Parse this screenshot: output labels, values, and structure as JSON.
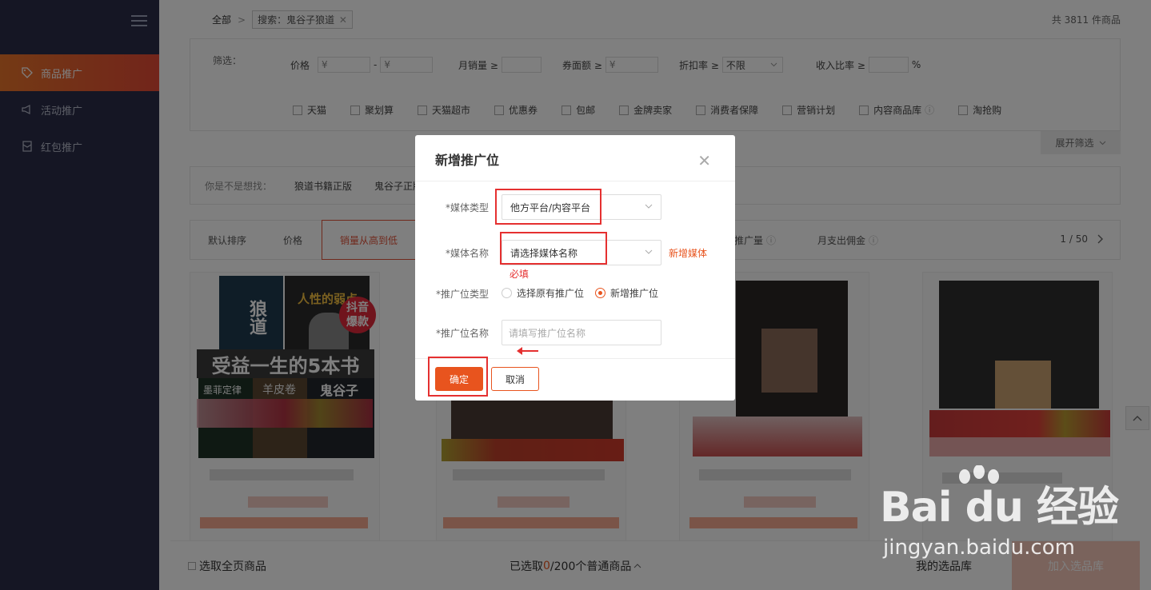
{
  "sidebar": {
    "items": [
      {
        "label": "商品推广",
        "icon": "tag-icon",
        "active": true
      },
      {
        "label": "活动推广",
        "icon": "megaphone-icon",
        "active": false
      },
      {
        "label": "红包推广",
        "icon": "red-packet-icon",
        "active": false
      }
    ]
  },
  "breadcrumb": {
    "root": "全部",
    "separator": ">",
    "search_tag": "搜索：鬼谷子狼道",
    "tag_close": "✕"
  },
  "total_text": "共 3811 件商品",
  "filters": {
    "label": "筛选：",
    "price_label": "价格",
    "price_from_placeholder": "¥",
    "price_dash": "-",
    "price_to_placeholder": "¥",
    "monthly_sales_label": "月销量 ≥",
    "coupon_label": "券面额 ≥",
    "coupon_placeholder": "¥",
    "discount_label": "折扣率 ≥",
    "discount_value": "不限",
    "commission_label": "收入比率 ≥",
    "percent": "%",
    "checkboxes": [
      "天猫",
      "聚划算",
      "天猫超市",
      "优惠券",
      "包邮",
      "金牌卖家",
      "消费者保障",
      "营销计划",
      "内容商品库",
      "淘抢购"
    ],
    "expand_label": "展开筛选"
  },
  "suggest": {
    "label": "你是不是想找：",
    "items": [
      "狼道书籍正版",
      "鬼谷子正版"
    ]
  },
  "sort": {
    "items": [
      "默认排序",
      "价格",
      "销量从高到低"
    ],
    "right_items": [
      "推广量",
      "月支出佣金"
    ],
    "pager": "1 / 50"
  },
  "product_card_1": {
    "book_title_1": "狼道",
    "book_title_2": "人性的弱点",
    "banner": "受益一生的5本书",
    "badge_line1": "抖音",
    "badge_line2": "爆款",
    "book_3": "墨菲定律",
    "book_4": "羊皮卷",
    "book_5": "鬼谷子"
  },
  "bottom_bar": {
    "select_all": "选取全页商品",
    "selected_prefix": "已选取",
    "selected_count": "0",
    "selected_suffix": "/200个普通商品",
    "my_library": "我的选品库",
    "add_library": "加入选品库"
  },
  "modal": {
    "title": "新增推广位",
    "close": "✕",
    "media_type_label": "*媒体类型",
    "media_type_value": "他方平台/内容平台",
    "media_name_label": "*媒体名称",
    "media_name_value": "请选择媒体名称",
    "new_media_link": "新增媒体",
    "required_hint": "必填",
    "position_type_label": "*推广位类型",
    "radio_existing": "选择原有推广位",
    "radio_new": "新增推广位",
    "position_name_label": "*推广位名称",
    "position_name_placeholder": "请填写推广位名称",
    "ok_label": "确定",
    "cancel_label": "取消"
  },
  "watermark": {
    "brand": "Bai du 经验",
    "url": "jingyan.baidu.com"
  },
  "colors": {
    "accent": "#e8541e",
    "sidebar_bg": "#2b2d49",
    "annotation_red": "#e53030"
  }
}
